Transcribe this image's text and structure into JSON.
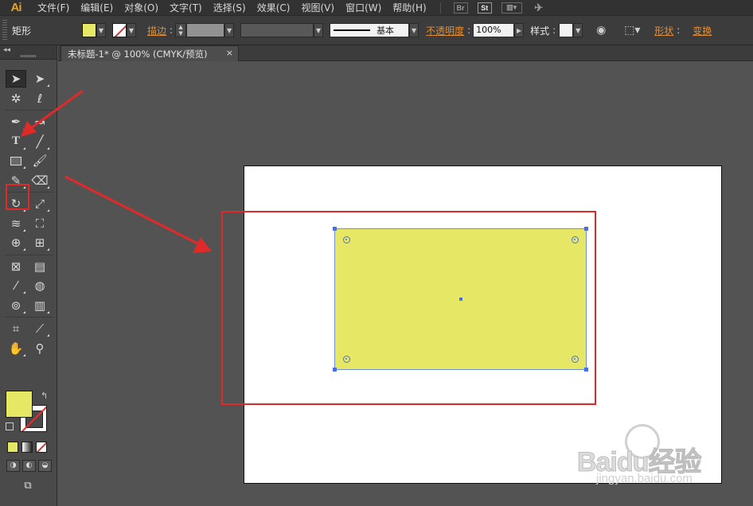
{
  "app": {
    "logo": "Ai"
  },
  "menu": [
    "文件(F)",
    "编辑(E)",
    "对象(O)",
    "文字(T)",
    "选择(S)",
    "效果(C)",
    "视图(V)",
    "窗口(W)",
    "帮助(H)"
  ],
  "menubar_icons": {
    "bridge": "Br",
    "stock": "St"
  },
  "control": {
    "object_type": "矩形",
    "stroke_label": "描边",
    "stroke_profile": "基本",
    "opacity_label": "不透明度",
    "opacity_value": "100%",
    "style_label": "样式",
    "shape_label": "形状",
    "transform_label": "变换"
  },
  "document": {
    "tab_title": "未标题-1* @ 100% (CMYK/预览)",
    "close_glyph": "×"
  },
  "colors": {
    "fill": "#e6e865",
    "accent": "#e02a2a",
    "selection": "#4b6fe0",
    "link": "#e38d2e"
  },
  "tools": [
    [
      "selection-tool",
      "direct-selection-tool"
    ],
    [
      "magic-wand-tool",
      "lasso-tool"
    ],
    [
      "pen-tool",
      "curvature-tool"
    ],
    [
      "type-tool",
      "line-segment-tool"
    ],
    [
      "rectangle-tool",
      "paintbrush-tool"
    ],
    [
      "pencil-tool",
      "eraser-tool"
    ],
    [
      "rotate-tool",
      "scale-tool"
    ],
    [
      "width-tool",
      "free-transform-tool"
    ],
    [
      "shape-builder-tool",
      "perspective-grid-tool"
    ],
    [
      "mesh-tool",
      "gradient-tool"
    ],
    [
      "eyedropper-tool",
      "blend-tool"
    ],
    [
      "symbol-sprayer-tool",
      "column-graph-tool"
    ],
    [
      "artboard-tool",
      "slice-tool"
    ],
    [
      "hand-tool",
      "zoom-tool"
    ]
  ],
  "watermark": {
    "brand": "Baidu经验",
    "url": "jingyan.baidu.com"
  }
}
